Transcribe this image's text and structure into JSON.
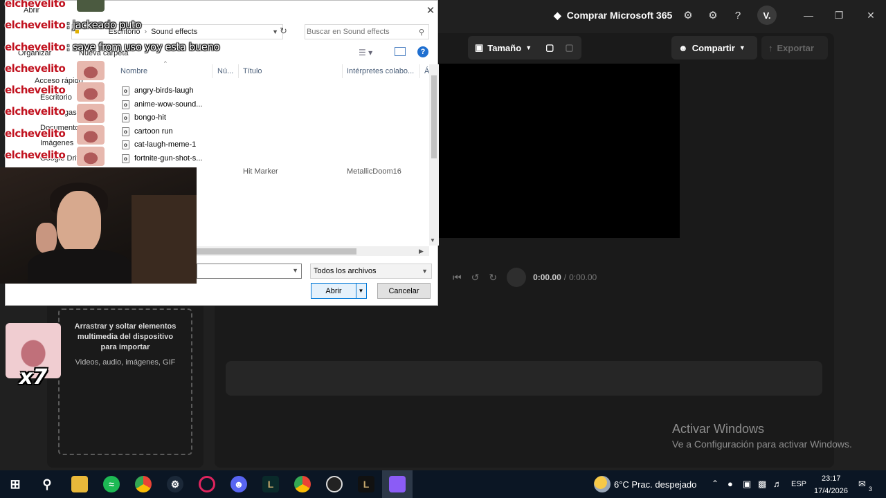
{
  "app": {
    "buy_label": "Comprar Microsoft 365",
    "avatar_initial": "V.",
    "size_label": "Tamaño",
    "share_label": "Compartir",
    "export_label": "Exportar",
    "time_current": "0:00.00",
    "time_sep": "/",
    "time_total": "0:00.00",
    "drop_title": "Arrastrar y soltar elementos multimedia del dispositivo para importar",
    "drop_sub": "Videos, audio, imágenes, GIF",
    "activate_title": "Activar Windows",
    "activate_sub": "Ve a Configuración para activar Windows."
  },
  "dialog": {
    "title": "Abrir",
    "breadcrumb": [
      "Escritorio",
      "Sound effects"
    ],
    "search_placeholder": "Buscar en Sound effects",
    "organize_label": "Organizar",
    "new_folder_label": "Nueva carpeta",
    "nav": [
      "Acceso rápido",
      "Escritorio",
      "Descargas",
      "Documentos",
      "Imágenes",
      "Google Drive"
    ],
    "columns": [
      "Nombre",
      "Nú...",
      "Título",
      "Intérpretes colabo...",
      "Á"
    ],
    "files": [
      {
        "name": "angry-birds-laugh",
        "title": "",
        "artist": ""
      },
      {
        "name": "anime-wow-sound...",
        "title": "",
        "artist": ""
      },
      {
        "name": "bongo-hit",
        "title": "",
        "artist": ""
      },
      {
        "name": "cartoon run",
        "title": "",
        "artist": ""
      },
      {
        "name": "cat-laugh-meme-1",
        "title": "",
        "artist": ""
      },
      {
        "name": "fortnite-gun-shot-s...",
        "title": "",
        "artist": ""
      },
      {
        "name": "",
        "title": "Hit Marker",
        "artist": "MetallicDoom16"
      }
    ],
    "file_type": "Todos los archivos",
    "open_button": "Abrir",
    "cancel_button": "Cancelar"
  },
  "chat": [
    {
      "user": "elchevelito",
      "message": ": jackeado puto"
    },
    {
      "user": "elchevelito",
      "message": ": save from uso yoy esta bueno"
    },
    {
      "user": "elchevelito",
      "message": ""
    },
    {
      "user": "elchevelito",
      "message": ""
    },
    {
      "user": "elchevelito",
      "message": ""
    },
    {
      "user": "elchevelito",
      "message": ""
    },
    {
      "user": "elchevelito",
      "message": ""
    }
  ],
  "sticker_count": "x7",
  "taskbar": {
    "weather": "6°C  Prac. despejado",
    "language": "ESP",
    "time": "23:17",
    "date": "17/4/2026",
    "notifications": "3",
    "pinned": [
      "windows-icon",
      "search-icon",
      "file-explorer-icon",
      "spotify-icon",
      "chrome-icon",
      "steam-icon",
      "opera-gx-icon",
      "discord-icon",
      "league-icon",
      "chrome-icon",
      "obs-icon",
      "league-client-icon",
      "clipchamp-icon"
    ]
  },
  "colors": {
    "accent": "#0078d7",
    "chat_name": "#c1121f",
    "app_bg": "#202020",
    "taskbar_bg": "#0b1624"
  }
}
